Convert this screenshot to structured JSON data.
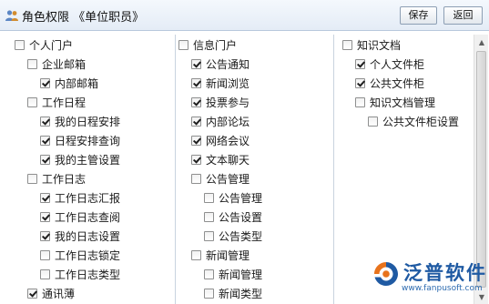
{
  "title": "角色权限 《单位职员》",
  "buttons": {
    "save": "保存",
    "back": "返回"
  },
  "columns": [
    {
      "items": [
        {
          "label": "个人门户",
          "level": 0,
          "checked": false
        },
        {
          "label": "企业邮箱",
          "level": 1,
          "checked": false
        },
        {
          "label": "内部邮箱",
          "level": 2,
          "checked": true
        },
        {
          "label": "工作日程",
          "level": 1,
          "checked": false
        },
        {
          "label": "我的日程安排",
          "level": 2,
          "checked": true
        },
        {
          "label": "日程安排查询",
          "level": 2,
          "checked": true
        },
        {
          "label": "我的主管设置",
          "level": 2,
          "checked": true
        },
        {
          "label": "工作日志",
          "level": 1,
          "checked": false
        },
        {
          "label": "工作日志汇报",
          "level": 2,
          "checked": true
        },
        {
          "label": "工作日志查阅",
          "level": 2,
          "checked": true
        },
        {
          "label": "我的日志设置",
          "level": 2,
          "checked": true
        },
        {
          "label": "工作日志锁定",
          "level": 2,
          "checked": false
        },
        {
          "label": "工作日志类型",
          "level": 2,
          "checked": false
        },
        {
          "label": "通讯薄",
          "level": 1,
          "checked": true
        }
      ]
    },
    {
      "items": [
        {
          "label": "信息门户",
          "level": 0,
          "checked": false
        },
        {
          "label": "公告通知",
          "level": 1,
          "checked": true
        },
        {
          "label": "新闻浏览",
          "level": 1,
          "checked": true
        },
        {
          "label": "投票参与",
          "level": 1,
          "checked": true
        },
        {
          "label": "内部论坛",
          "level": 1,
          "checked": true
        },
        {
          "label": "网络会议",
          "level": 1,
          "checked": true
        },
        {
          "label": "文本聊天",
          "level": 1,
          "checked": true
        },
        {
          "label": "公告管理",
          "level": 1,
          "checked": false
        },
        {
          "label": "公告管理",
          "level": 2,
          "checked": false
        },
        {
          "label": "公告设置",
          "level": 2,
          "checked": false
        },
        {
          "label": "公告类型",
          "level": 2,
          "checked": false
        },
        {
          "label": "新闻管理",
          "level": 1,
          "checked": false
        },
        {
          "label": "新闻管理",
          "level": 2,
          "checked": false
        },
        {
          "label": "新闻类型",
          "level": 2,
          "checked": false
        }
      ]
    },
    {
      "items": [
        {
          "label": "知识文档",
          "level": 0,
          "checked": false
        },
        {
          "label": "个人文件柜",
          "level": 1,
          "checked": true
        },
        {
          "label": "公共文件柜",
          "level": 1,
          "checked": true
        },
        {
          "label": "知识文档管理",
          "level": 1,
          "checked": false
        },
        {
          "label": "公共文件柜设置",
          "level": 2,
          "checked": false
        }
      ]
    }
  ],
  "logo": {
    "name": "泛普软件",
    "url": "www.fanpusoft.com"
  },
  "icons": {
    "title": "users-icon",
    "logo": "fanpu-logo-icon"
  },
  "colors": {
    "logo_blue": "#1f5aa3",
    "logo_orange": "#e8731c",
    "title_bar": "#e4ecf6"
  }
}
